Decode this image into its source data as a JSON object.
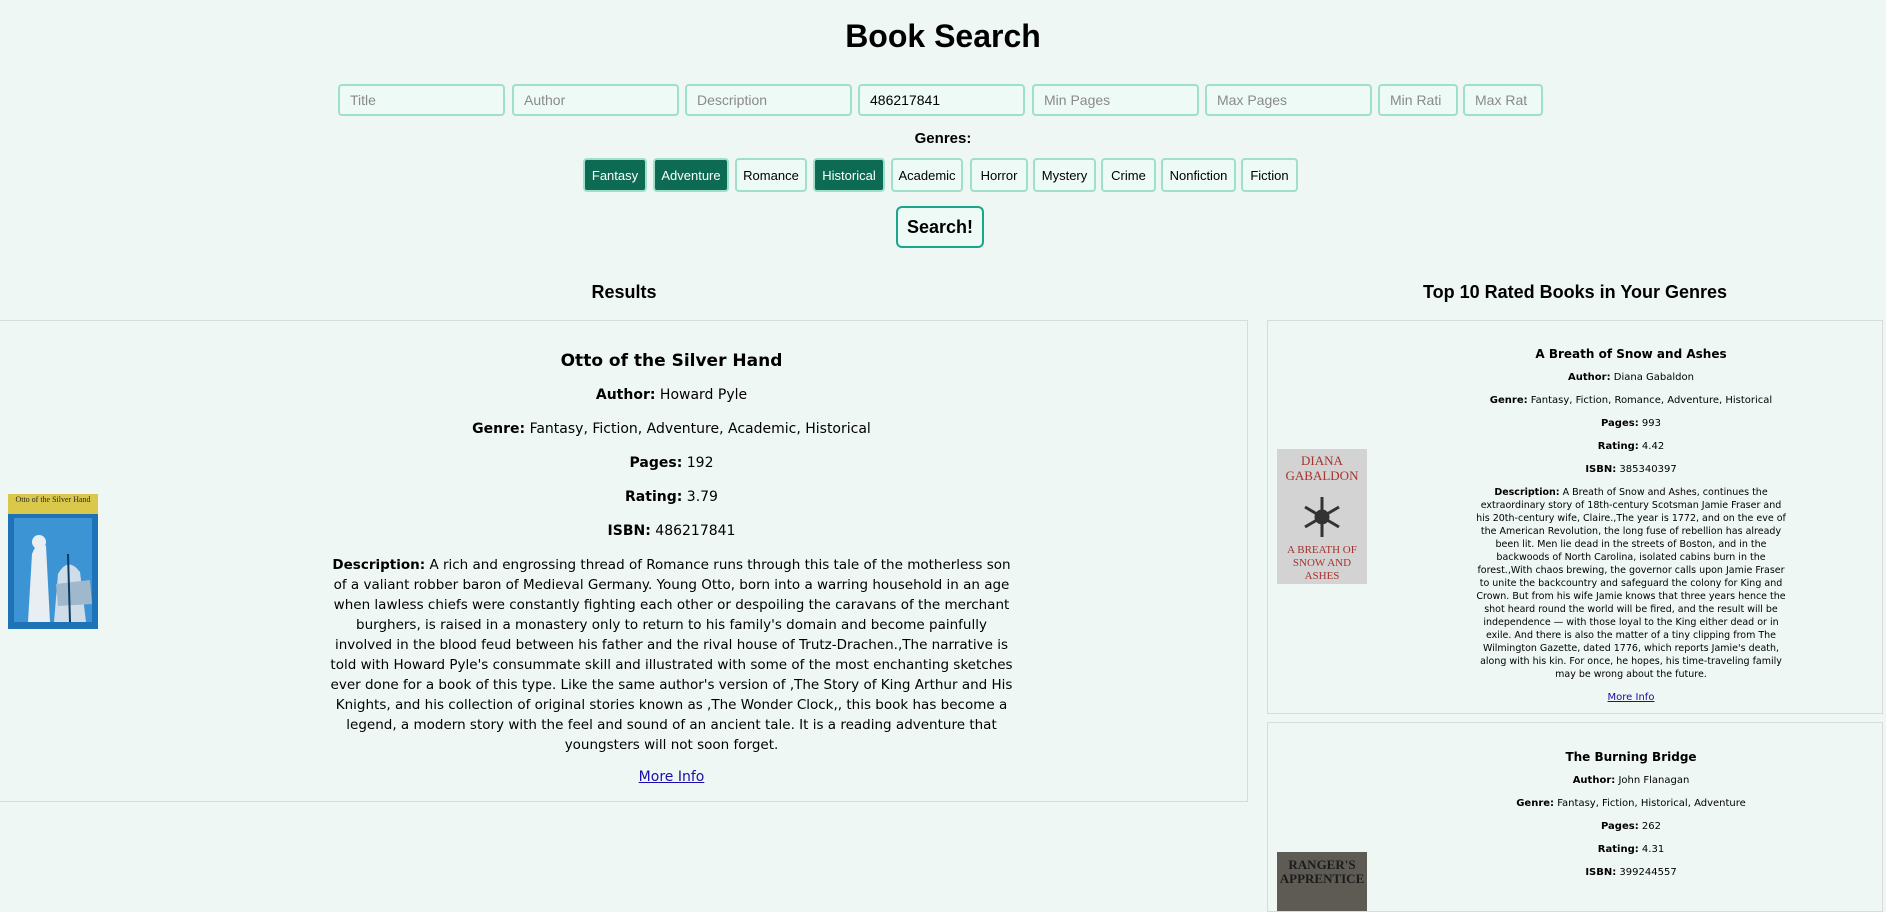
{
  "page": {
    "title": "Book Search"
  },
  "search": {
    "title_placeholder": "Title",
    "author_placeholder": "Author",
    "description_placeholder": "Description",
    "isbn_value": "486217841",
    "min_pages_placeholder": "Min Pages",
    "max_pages_placeholder": "Max Pages",
    "min_rating_placeholder": "Min Rati",
    "max_rating_placeholder": "Max Rat",
    "button_label": "Search!"
  },
  "genres": {
    "label": "Genres:",
    "items": [
      {
        "label": "Fantasy",
        "selected": true
      },
      {
        "label": "Adventure",
        "selected": true
      },
      {
        "label": "Romance",
        "selected": false
      },
      {
        "label": "Historical",
        "selected": true
      },
      {
        "label": "Academic",
        "selected": false
      },
      {
        "label": "Horror",
        "selected": false
      },
      {
        "label": "Mystery",
        "selected": false
      },
      {
        "label": "Crime",
        "selected": false
      },
      {
        "label": "Nonfiction",
        "selected": false
      },
      {
        "label": "Fiction",
        "selected": false
      }
    ]
  },
  "results": {
    "heading": "Results",
    "book": {
      "title": "Otto of the Silver Hand",
      "author_label": "Author:",
      "author": "Howard Pyle",
      "genre_label": "Genre:",
      "genre": "Fantasy, Fiction, Adventure, Academic, Historical",
      "pages_label": "Pages:",
      "pages": "192",
      "rating_label": "Rating:",
      "rating": "3.79",
      "isbn_label": "ISBN:",
      "isbn": "486217841",
      "description_label": "Description:",
      "description": "A rich and engrossing thread of Romance runs through this tale of the motherless son of a valiant robber baron of Medieval Germany. Young Otto, born into a warring household in an age when lawless chiefs were constantly fighting each other or despoiling the caravans of the merchant burghers, is raised in a monastery only to return to his family's domain and become painfully involved in the blood feud between his father and the rival house of Trutz-Drachen.,The narrative is told with Howard Pyle's consummate skill and illustrated with some of the most enchanting sketches ever done for a book of this type. Like the same author's version of ,The Story of King Arthur and His Knights, and his collection of original stories known as ,The Wonder Clock,, this book has become a legend, a modern story with the feel and sound of an ancient tale. It is a reading adventure that youngsters will not soon forget.",
      "more_info": "More Info",
      "cover_text": "Otto of the Silver Hand"
    }
  },
  "top_rated": {
    "heading": "Top 10 Rated Books in Your Genres",
    "books": [
      {
        "title": "A Breath of Snow and Ashes",
        "author_label": "Author:",
        "author": "Diana Gabaldon",
        "genre_label": "Genre:",
        "genre": "Fantasy, Fiction, Romance, Adventure, Historical",
        "pages_label": "Pages:",
        "pages": "993",
        "rating_label": "Rating:",
        "rating": "4.42",
        "isbn_label": "ISBN:",
        "isbn": "385340397",
        "description_label": "Description:",
        "description": "A Breath of Snow and Ashes, continues the extraordinary story of 18th-century Scotsman Jamie Fraser and his 20th-century wife, Claire.,The year is 1772, and on the eve of the American Revolution, the long fuse of rebellion has already been lit. Men lie dead in the streets of Boston, and in the backwoods of North Carolina, isolated cabins burn in the forest.,With chaos brewing, the governor calls upon Jamie Fraser to unite the backcountry and safeguard the colony for King and Crown. But from his wife Jamie knows that three years hence the shot heard round the world will be fired, and the result will be independence — with those loyal to the King either dead or in exile. And there is also the matter of a tiny clipping from The Wilmington Gazette, dated 1776, which reports Jamie's death, along with his kin. For once, he hopes, his time-traveling family may be wrong about the future.",
        "more_info": "More Info",
        "cover_top": "DIANA GABALDON",
        "cover_bottom": "A BREATH OF SNOW AND ASHES"
      },
      {
        "title": "The Burning Bridge",
        "author_label": "Author:",
        "author": "John Flanagan",
        "genre_label": "Genre:",
        "genre": "Fantasy, Fiction, Historical, Adventure",
        "pages_label": "Pages:",
        "pages": "262",
        "rating_label": "Rating:",
        "rating": "4.31",
        "isbn_label": "ISBN:",
        "isbn": "399244557",
        "cover_top": "RANGER'S APPRENTICE"
      }
    ]
  }
}
